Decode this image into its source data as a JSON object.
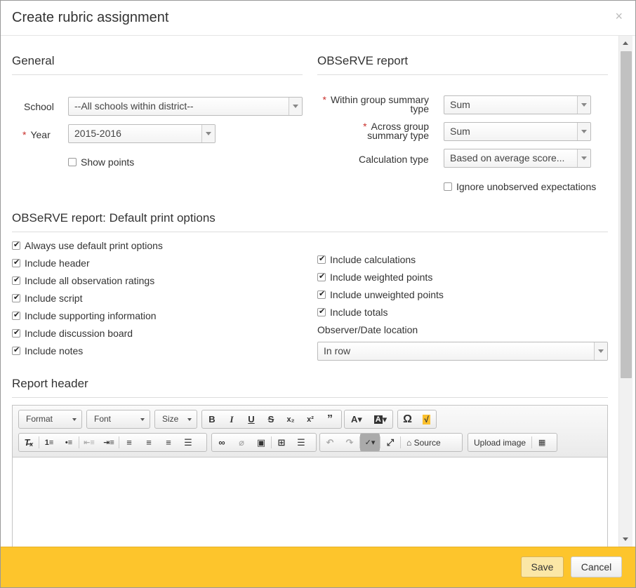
{
  "dialog": {
    "title": "Create rubric assignment",
    "close_glyph": "×"
  },
  "general": {
    "title": "General",
    "school": {
      "label": "School",
      "value": "--All schools within district--"
    },
    "year": {
      "required_mark": "*",
      "label": "Year",
      "value": "2015-2016"
    },
    "show_points": {
      "label": "Show points",
      "checked": false
    }
  },
  "observe_report": {
    "title": "OBSeRVE report",
    "within_group": {
      "required_mark": "*",
      "label_line1": "Within group summary",
      "label_line2": "type",
      "value": "Sum"
    },
    "across_group": {
      "required_mark": "*",
      "label_line1": "Across group",
      "label_line2": "summary type",
      "value": "Sum"
    },
    "calculation_type": {
      "label": "Calculation type",
      "value": "Based on average score..."
    },
    "ignore_unobserved": {
      "label": "Ignore unobserved expectations",
      "checked": false
    }
  },
  "print_options": {
    "title": "OBSeRVE report: Default print options",
    "left": [
      {
        "label": "Always use default print options",
        "checked": true
      },
      {
        "label": "Include header",
        "checked": true
      },
      {
        "label": "Include all observation ratings",
        "checked": true
      },
      {
        "label": "Include script",
        "checked": true
      },
      {
        "label": "Include supporting information",
        "checked": true
      },
      {
        "label": "Include discussion board",
        "checked": true
      },
      {
        "label": "Include notes",
        "checked": true
      }
    ],
    "right": [
      {
        "label": "Include calculations",
        "checked": true
      },
      {
        "label": "Include weighted points",
        "checked": true
      },
      {
        "label": "Include unweighted points",
        "checked": true
      },
      {
        "label": "Include totals",
        "checked": true
      }
    ],
    "observer_location": {
      "label": "Observer/Date location",
      "value": "In row"
    }
  },
  "report_header": {
    "title": "Report header",
    "toolbar": {
      "format": "Format",
      "font": "Font",
      "size": "Size",
      "source": "Source",
      "upload_image": "Upload image"
    }
  },
  "footer": {
    "save": "Save",
    "cancel": "Cancel"
  },
  "colors": {
    "footer_bg": "#fdc52c",
    "required": "#c9302c"
  }
}
